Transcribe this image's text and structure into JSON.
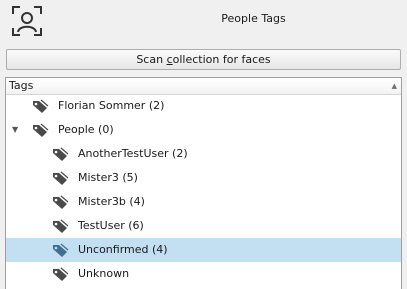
{
  "header": {
    "title": "People Tags",
    "icon": "face-frame-icon"
  },
  "scan_button": {
    "label_before": "Scan ",
    "label_underline": "c",
    "label_after": "ollection for faces"
  },
  "tree": {
    "column_header": "Tags",
    "items": [
      {
        "label": "Florian Sommer (2)",
        "icon": "tag-icon",
        "selected": false
      },
      {
        "label": "People (0)",
        "icon": "tag-icon",
        "expanded": true,
        "selected": false
      },
      {
        "label": "AnotherTestUser (2)",
        "icon": "tag-icon",
        "selected": false
      },
      {
        "label": "Mister3 (5)",
        "icon": "tag-icon",
        "selected": false
      },
      {
        "label": "Mister3b (4)",
        "icon": "tag-icon",
        "selected": false
      },
      {
        "label": "TestUser (6)",
        "icon": "tag-icon",
        "selected": false
      },
      {
        "label": "Unconfirmed (4)",
        "icon": "tag-icon",
        "selected": true
      },
      {
        "label": "Unknown",
        "icon": "tag-icon",
        "selected": false
      }
    ]
  },
  "colors": {
    "selection": "#c3dff2",
    "tag_icon": "#4a4a4a",
    "tag_icon_selected": "#3e6f8f"
  }
}
